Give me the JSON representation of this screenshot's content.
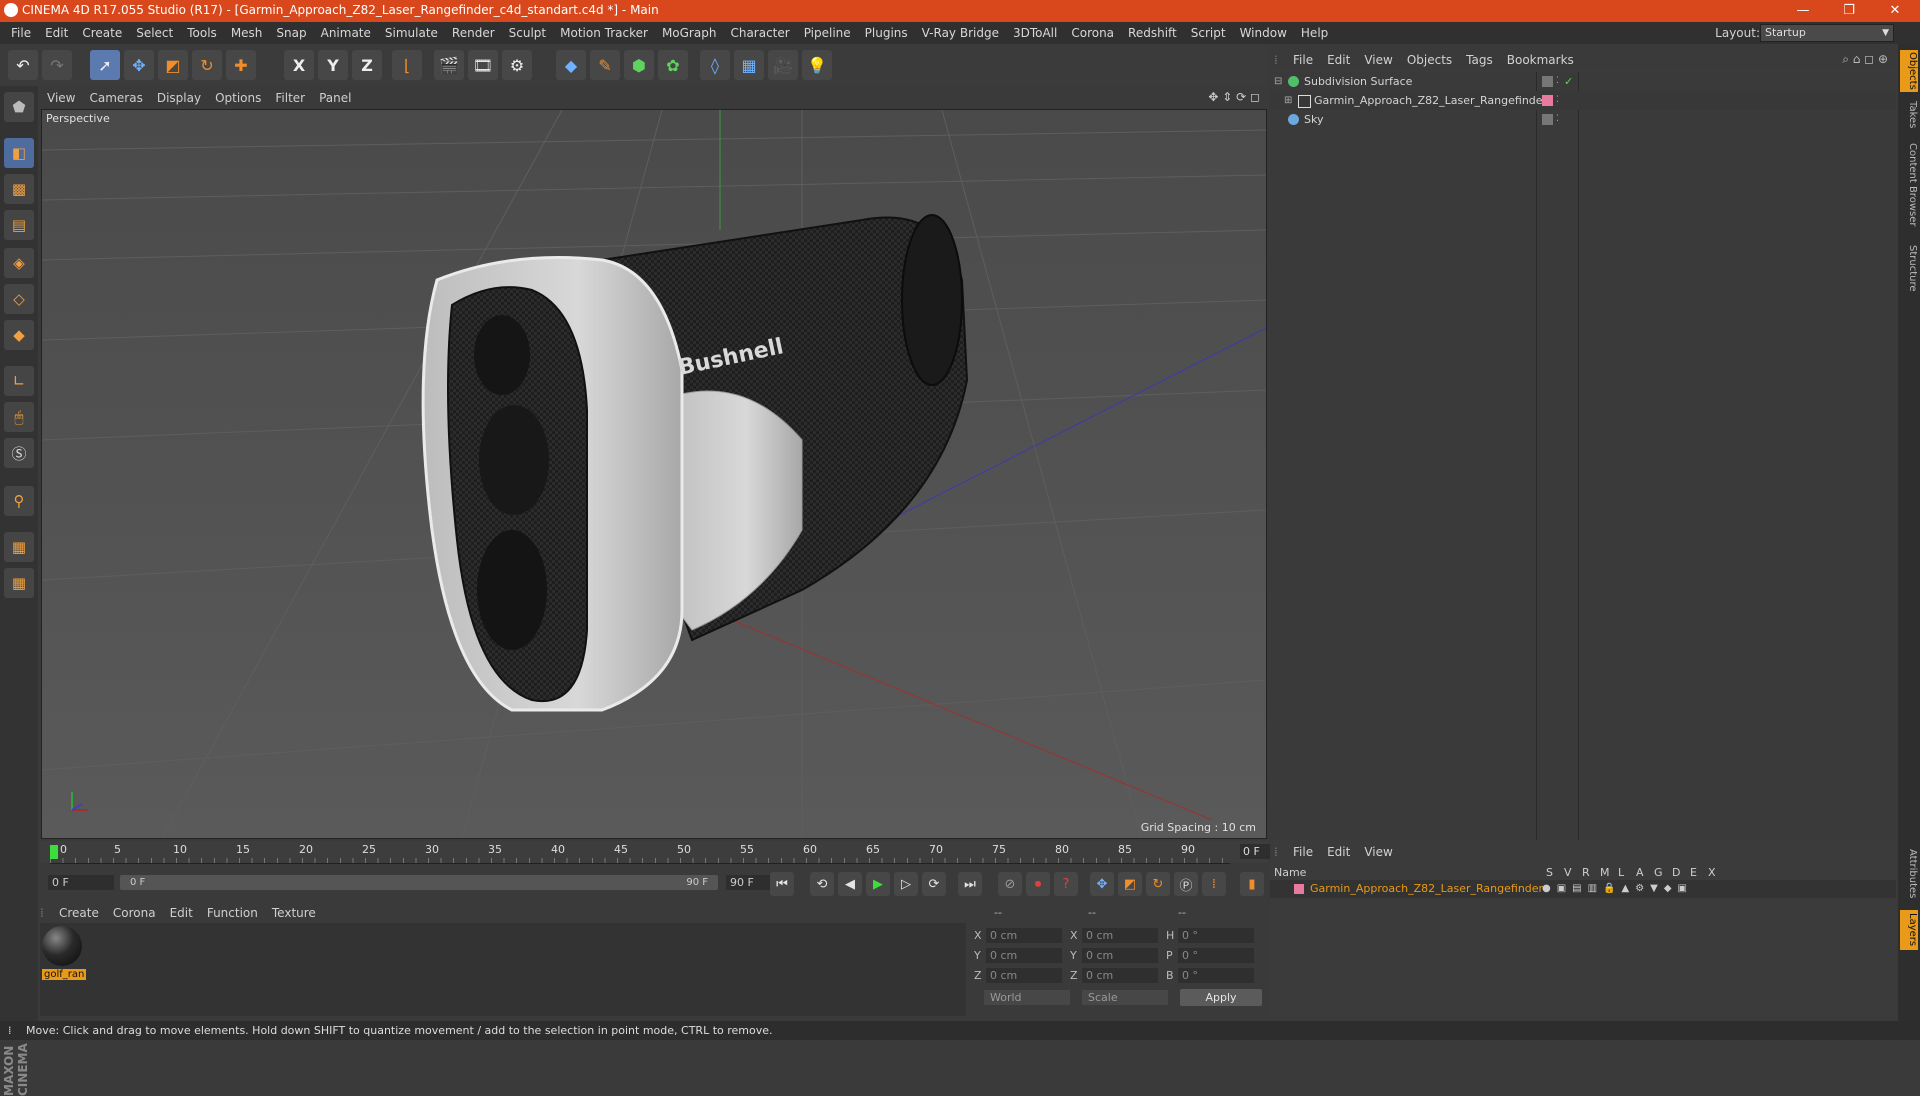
{
  "window": {
    "title": "CINEMA 4D R17.055 Studio (R17) - [Garmin_Approach_Z82_Laser_Rangefinder_c4d_standart.c4d *] - Main",
    "minimize": "—",
    "restore": "❐",
    "close": "✕"
  },
  "menubar": {
    "items": [
      "File",
      "Edit",
      "Create",
      "Select",
      "Tools",
      "Mesh",
      "Snap",
      "Animate",
      "Simulate",
      "Render",
      "Sculpt",
      "Motion Tracker",
      "MoGraph",
      "Character",
      "Pipeline",
      "Plugins",
      "V-Ray Bridge",
      "3DToAll",
      "Corona",
      "Redshift",
      "Script",
      "Window",
      "Help"
    ],
    "layout_label": "Layout:",
    "layout_value": "Startup"
  },
  "toolbar": {
    "x_axis": "X",
    "y_axis": "Y",
    "z_axis": "Z"
  },
  "viewport": {
    "menu": [
      "View",
      "Cameras",
      "Display",
      "Options",
      "Filter",
      "Panel"
    ],
    "camera_label": "Perspective",
    "grid_spacing": "Grid Spacing : 10 cm",
    "model_logo_text": "Bushnell"
  },
  "timeline": {
    "ticks": [
      "0",
      "5",
      "10",
      "15",
      "20",
      "25",
      "30",
      "35",
      "40",
      "45",
      "50",
      "55",
      "60",
      "65",
      "70",
      "75",
      "80",
      "85",
      "90"
    ],
    "current_frame": "0 F",
    "start_field": "0 F",
    "range_start": "0 F",
    "range_end": "90 F",
    "end_field": "90 F"
  },
  "material_manager": {
    "menu": [
      "Create",
      "Corona",
      "Edit",
      "Function",
      "Texture"
    ],
    "materials": [
      {
        "name": "golf_ran"
      }
    ]
  },
  "coordinates": {
    "header": [
      "--",
      "--",
      "--"
    ],
    "rows": [
      {
        "axis": "X",
        "pos": "0 cm",
        "axis2": "X",
        "size": "0 cm",
        "rot_label": "H",
        "rot": "0 °"
      },
      {
        "axis": "Y",
        "pos": "0 cm",
        "axis2": "Y",
        "size": "0 cm",
        "rot_label": "P",
        "rot": "0 °"
      },
      {
        "axis": "Z",
        "pos": "0 cm",
        "axis2": "Z",
        "size": "0 cm",
        "rot_label": "B",
        "rot": "0 °"
      }
    ],
    "space_select": "World",
    "mode_select": "Scale",
    "apply_label": "Apply"
  },
  "object_manager": {
    "menu": [
      "File",
      "Edit",
      "View",
      "Objects",
      "Tags",
      "Bookmarks"
    ],
    "objects": [
      {
        "name": "Subdivision Surface",
        "icon_color": "#4fbf6a"
      },
      {
        "name": "Garmin_Approach_Z82_Laser_Rangefinder",
        "icon_color": "#9a9a9a"
      },
      {
        "name": "Sky",
        "icon_color": "#6aa8e0"
      }
    ]
  },
  "layer_manager": {
    "menu": [
      "File",
      "Edit",
      "View"
    ],
    "columns": [
      "Name",
      "S",
      "V",
      "R",
      "M",
      "L",
      "A",
      "G",
      "D",
      "E",
      "X"
    ],
    "layers": [
      {
        "name": "Garmin_Approach_Z82_Laser_Rangefinder",
        "color": "#e87aa0"
      }
    ]
  },
  "right_tabs": [
    "Objects",
    "Takes",
    "Content Browser",
    "Structure",
    "Attributes",
    "Layers"
  ],
  "status_bar": "Move: Click and drag to move elements. Hold down SHIFT to quantize movement / add to the selection in point mode, CTRL to remove.",
  "colors": {
    "titlebar": "#d8481c",
    "accent_orange": "#e89a18",
    "selection_blue": "#5a7ab0"
  }
}
